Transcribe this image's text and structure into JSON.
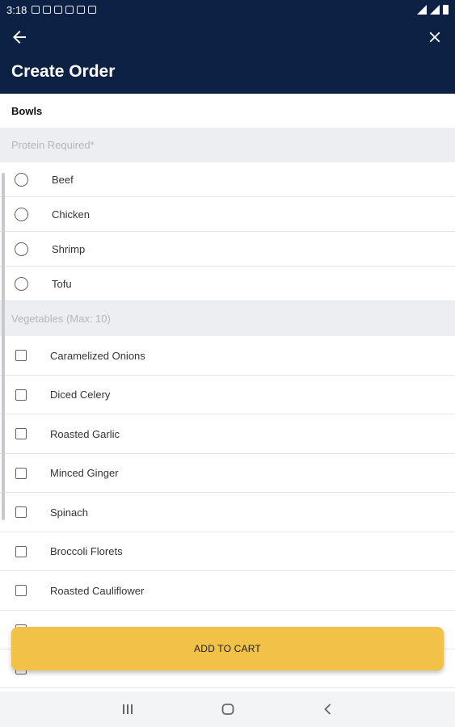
{
  "status_bar": {
    "time": "3:18"
  },
  "header": {
    "title": "Create Order",
    "back_icon": "arrow-back-icon",
    "close_icon": "close-icon"
  },
  "section": {
    "title": "Bowls"
  },
  "protein": {
    "header": "Protein Required*",
    "options": [
      "Beef",
      "Chicken",
      "Shrimp",
      "Tofu"
    ]
  },
  "vegetables": {
    "header": "Vegetables (Max: 10)",
    "options": [
      "Caramelized Onions",
      "Diced Celery",
      "Roasted Garlic",
      "Minced Ginger",
      "Spinach",
      "Broccoli Florets",
      "Roasted Cauliflower"
    ]
  },
  "cta": {
    "add_to_cart": "ADD TO CART"
  },
  "colors": {
    "app_bar": "#0c2143",
    "button": "#f2c148"
  }
}
